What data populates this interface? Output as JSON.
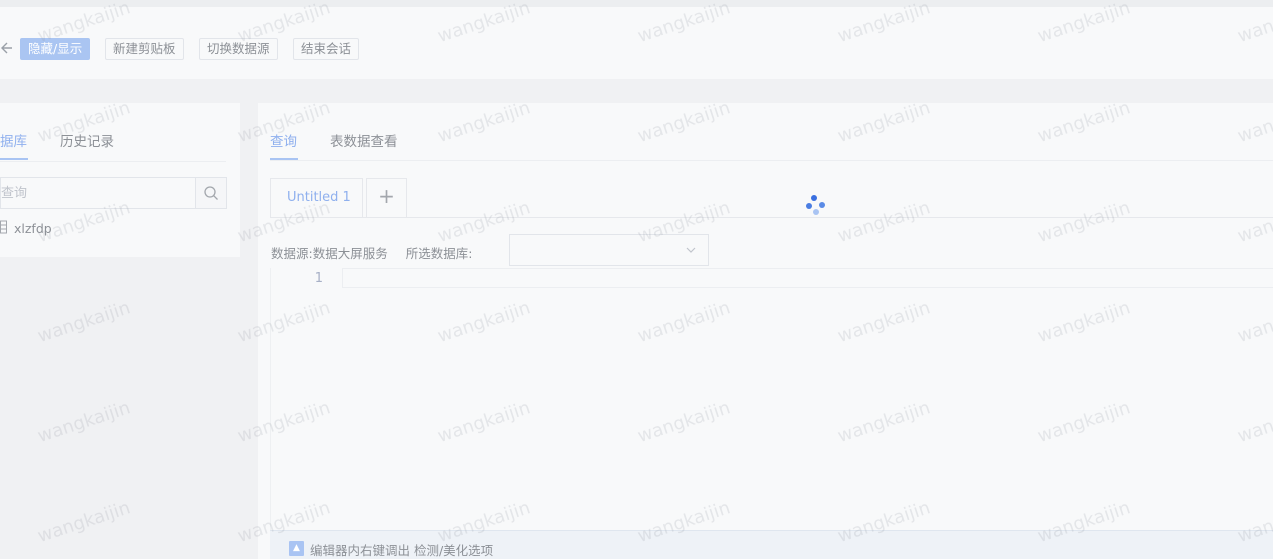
{
  "toolbar": {
    "back_icon": "arrow-left-icon",
    "buttons": [
      "隐藏/显示",
      "新建剪贴板",
      "切换数据源",
      "结束会话"
    ]
  },
  "left_panel": {
    "tabs": [
      "据库",
      "历史记录"
    ],
    "active_tab": 0,
    "search": {
      "value": "",
      "placeholder": "查询",
      "icon": "search-icon"
    },
    "tree": [
      {
        "icon": "database-icon",
        "label": "xlzfdp"
      }
    ]
  },
  "main_panel": {
    "tabs": [
      "查询",
      "表数据查看"
    ],
    "active_tab": 0,
    "editor_tabs": [
      "Untitled 1"
    ],
    "add_tab_label": "+",
    "datasource_label": "数据源:",
    "datasource_value": "数据大屏服务",
    "database_label": "所选数据库:",
    "database_value": "",
    "line_numbers": [
      "1"
    ],
    "hint": {
      "icon": "warning-triangle-icon",
      "text": "编辑器内右键调出 检测/美化选项"
    }
  },
  "loading": {
    "icon": "loading-spinner-icon"
  },
  "watermark": "wangkaijin",
  "colors": {
    "accent": "#a9c4f3",
    "primary_button": "#aac5f2",
    "spinner": "#3a6fe0",
    "hint_bar": "#eef2f7"
  }
}
